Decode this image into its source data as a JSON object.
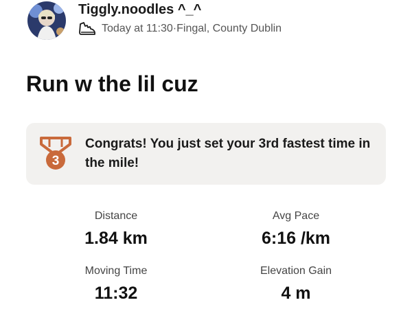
{
  "header": {
    "username": "Tiggly.noodles ^_^",
    "timestamp": "Today at 11:30",
    "separator": " · ",
    "location": "Fingal, County Dublin",
    "activity_icon": "running-shoe-icon"
  },
  "activity": {
    "title": "Run w the lil cuz"
  },
  "achievement": {
    "icon": "bronze-medal-icon",
    "medal_number": "3",
    "text": "Congrats! You just set your 3rd fastest time in the mile!",
    "colors": {
      "medal": "#c96a3b",
      "background": "#f2f1ef"
    }
  },
  "stats": [
    {
      "label": "Distance",
      "value": "1.84 km"
    },
    {
      "label": "Avg Pace",
      "value": "6:16 /km"
    },
    {
      "label": "Moving Time",
      "value": "11:32"
    },
    {
      "label": "Elevation Gain",
      "value": "4 m"
    }
  ]
}
